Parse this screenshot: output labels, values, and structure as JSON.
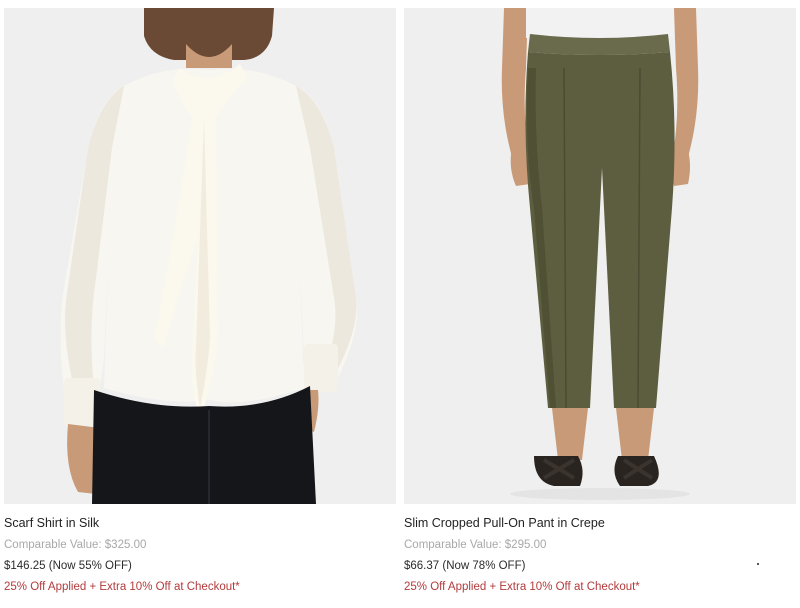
{
  "products": [
    {
      "image_alt": "Scarf Shirt in Silk",
      "name": "Scarf Shirt in Silk",
      "comparable": "Comparable Value: $325.00",
      "price": "$146.25 (Now 55% OFF)",
      "promo": "25% Off Applied + Extra 10% Off at Checkout*"
    },
    {
      "image_alt": "Slim Cropped Pull-On Pant in Crepe",
      "name": "Slim Cropped Pull-On Pant in Crepe",
      "comparable": "Comparable Value: $295.00",
      "price": "$66.37 (Now 78% OFF)",
      "promo": "25% Off Applied + Extra 10% Off at Checkout*"
    }
  ],
  "colors": {
    "image_bg": "#efefef",
    "promo": "#b23b3b",
    "muted": "#a8a8a8",
    "shirt": "#f8f6f0",
    "trousers_black": "#14161a",
    "pants_olive": "#5d5e40"
  }
}
